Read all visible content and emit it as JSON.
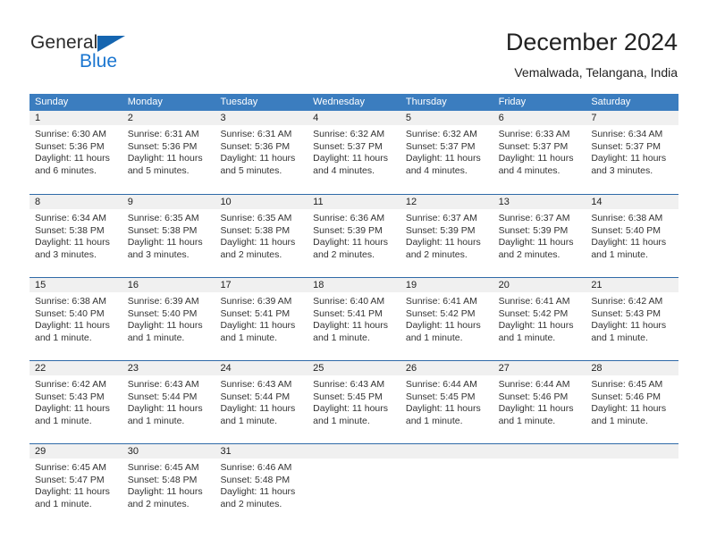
{
  "brand": {
    "name_part1": "General",
    "name_part2": "Blue",
    "triangle_color": "#1565b0",
    "blue_color": "#1b76d0"
  },
  "header": {
    "title": "December 2024",
    "subtitle": "Vemalwada, Telangana, India"
  },
  "calendar": {
    "header_bg": "#3b7dbf",
    "day_number_bg": "#f0f0f0",
    "weekdays": [
      "Sunday",
      "Monday",
      "Tuesday",
      "Wednesday",
      "Thursday",
      "Friday",
      "Saturday"
    ],
    "weeks": [
      [
        {
          "day": "1",
          "lines": [
            "Sunrise: 6:30 AM",
            "Sunset: 5:36 PM",
            "Daylight: 11 hours",
            "and 6 minutes."
          ]
        },
        {
          "day": "2",
          "lines": [
            "Sunrise: 6:31 AM",
            "Sunset: 5:36 PM",
            "Daylight: 11 hours",
            "and 5 minutes."
          ]
        },
        {
          "day": "3",
          "lines": [
            "Sunrise: 6:31 AM",
            "Sunset: 5:36 PM",
            "Daylight: 11 hours",
            "and 5 minutes."
          ]
        },
        {
          "day": "4",
          "lines": [
            "Sunrise: 6:32 AM",
            "Sunset: 5:37 PM",
            "Daylight: 11 hours",
            "and 4 minutes."
          ]
        },
        {
          "day": "5",
          "lines": [
            "Sunrise: 6:32 AM",
            "Sunset: 5:37 PM",
            "Daylight: 11 hours",
            "and 4 minutes."
          ]
        },
        {
          "day": "6",
          "lines": [
            "Sunrise: 6:33 AM",
            "Sunset: 5:37 PM",
            "Daylight: 11 hours",
            "and 4 minutes."
          ]
        },
        {
          "day": "7",
          "lines": [
            "Sunrise: 6:34 AM",
            "Sunset: 5:37 PM",
            "Daylight: 11 hours",
            "and 3 minutes."
          ]
        }
      ],
      [
        {
          "day": "8",
          "lines": [
            "Sunrise: 6:34 AM",
            "Sunset: 5:38 PM",
            "Daylight: 11 hours",
            "and 3 minutes."
          ]
        },
        {
          "day": "9",
          "lines": [
            "Sunrise: 6:35 AM",
            "Sunset: 5:38 PM",
            "Daylight: 11 hours",
            "and 3 minutes."
          ]
        },
        {
          "day": "10",
          "lines": [
            "Sunrise: 6:35 AM",
            "Sunset: 5:38 PM",
            "Daylight: 11 hours",
            "and 2 minutes."
          ]
        },
        {
          "day": "11",
          "lines": [
            "Sunrise: 6:36 AM",
            "Sunset: 5:39 PM",
            "Daylight: 11 hours",
            "and 2 minutes."
          ]
        },
        {
          "day": "12",
          "lines": [
            "Sunrise: 6:37 AM",
            "Sunset: 5:39 PM",
            "Daylight: 11 hours",
            "and 2 minutes."
          ]
        },
        {
          "day": "13",
          "lines": [
            "Sunrise: 6:37 AM",
            "Sunset: 5:39 PM",
            "Daylight: 11 hours",
            "and 2 minutes."
          ]
        },
        {
          "day": "14",
          "lines": [
            "Sunrise: 6:38 AM",
            "Sunset: 5:40 PM",
            "Daylight: 11 hours",
            "and 1 minute."
          ]
        }
      ],
      [
        {
          "day": "15",
          "lines": [
            "Sunrise: 6:38 AM",
            "Sunset: 5:40 PM",
            "Daylight: 11 hours",
            "and 1 minute."
          ]
        },
        {
          "day": "16",
          "lines": [
            "Sunrise: 6:39 AM",
            "Sunset: 5:40 PM",
            "Daylight: 11 hours",
            "and 1 minute."
          ]
        },
        {
          "day": "17",
          "lines": [
            "Sunrise: 6:39 AM",
            "Sunset: 5:41 PM",
            "Daylight: 11 hours",
            "and 1 minute."
          ]
        },
        {
          "day": "18",
          "lines": [
            "Sunrise: 6:40 AM",
            "Sunset: 5:41 PM",
            "Daylight: 11 hours",
            "and 1 minute."
          ]
        },
        {
          "day": "19",
          "lines": [
            "Sunrise: 6:41 AM",
            "Sunset: 5:42 PM",
            "Daylight: 11 hours",
            "and 1 minute."
          ]
        },
        {
          "day": "20",
          "lines": [
            "Sunrise: 6:41 AM",
            "Sunset: 5:42 PM",
            "Daylight: 11 hours",
            "and 1 minute."
          ]
        },
        {
          "day": "21",
          "lines": [
            "Sunrise: 6:42 AM",
            "Sunset: 5:43 PM",
            "Daylight: 11 hours",
            "and 1 minute."
          ]
        }
      ],
      [
        {
          "day": "22",
          "lines": [
            "Sunrise: 6:42 AM",
            "Sunset: 5:43 PM",
            "Daylight: 11 hours",
            "and 1 minute."
          ]
        },
        {
          "day": "23",
          "lines": [
            "Sunrise: 6:43 AM",
            "Sunset: 5:44 PM",
            "Daylight: 11 hours",
            "and 1 minute."
          ]
        },
        {
          "day": "24",
          "lines": [
            "Sunrise: 6:43 AM",
            "Sunset: 5:44 PM",
            "Daylight: 11 hours",
            "and 1 minute."
          ]
        },
        {
          "day": "25",
          "lines": [
            "Sunrise: 6:43 AM",
            "Sunset: 5:45 PM",
            "Daylight: 11 hours",
            "and 1 minute."
          ]
        },
        {
          "day": "26",
          "lines": [
            "Sunrise: 6:44 AM",
            "Sunset: 5:45 PM",
            "Daylight: 11 hours",
            "and 1 minute."
          ]
        },
        {
          "day": "27",
          "lines": [
            "Sunrise: 6:44 AM",
            "Sunset: 5:46 PM",
            "Daylight: 11 hours",
            "and 1 minute."
          ]
        },
        {
          "day": "28",
          "lines": [
            "Sunrise: 6:45 AM",
            "Sunset: 5:46 PM",
            "Daylight: 11 hours",
            "and 1 minute."
          ]
        }
      ],
      [
        {
          "day": "29",
          "lines": [
            "Sunrise: 6:45 AM",
            "Sunset: 5:47 PM",
            "Daylight: 11 hours",
            "and 1 minute."
          ]
        },
        {
          "day": "30",
          "lines": [
            "Sunrise: 6:45 AM",
            "Sunset: 5:48 PM",
            "Daylight: 11 hours",
            "and 2 minutes."
          ]
        },
        {
          "day": "31",
          "lines": [
            "Sunrise: 6:46 AM",
            "Sunset: 5:48 PM",
            "Daylight: 11 hours",
            "and 2 minutes."
          ]
        },
        {
          "day": "",
          "lines": []
        },
        {
          "day": "",
          "lines": []
        },
        {
          "day": "",
          "lines": []
        },
        {
          "day": "",
          "lines": []
        }
      ]
    ]
  }
}
